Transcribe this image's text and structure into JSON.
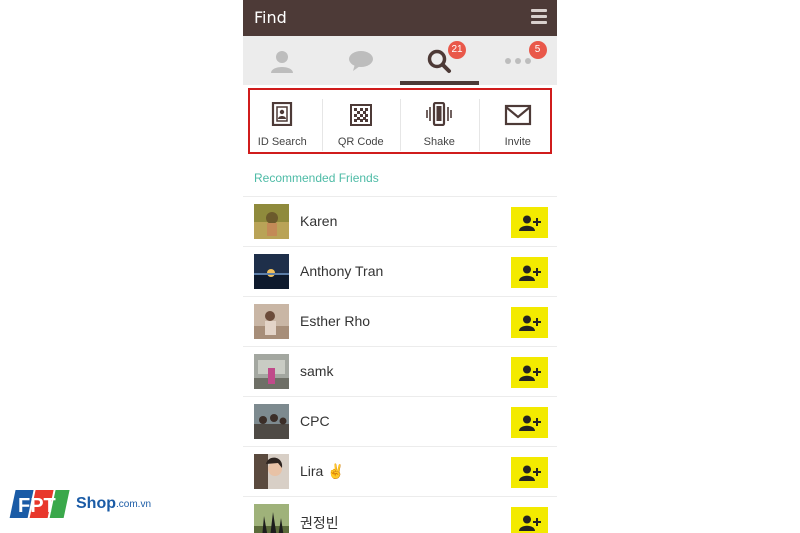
{
  "header": {
    "title": "Find"
  },
  "tabs": [
    {
      "name": "friends",
      "icon": "person-icon",
      "badge": ""
    },
    {
      "name": "chats",
      "icon": "chat-bubble-icon",
      "badge": ""
    },
    {
      "name": "find",
      "icon": "search-icon",
      "badge": "21",
      "active": true
    },
    {
      "name": "more",
      "icon": "more-icon",
      "badge": "5"
    }
  ],
  "actions": [
    {
      "label": "ID Search",
      "icon": "id-card-icon"
    },
    {
      "label": "QR Code",
      "icon": "qr-code-icon"
    },
    {
      "label": "Shake",
      "icon": "shake-phone-icon"
    },
    {
      "label": "Invite",
      "icon": "envelope-icon"
    }
  ],
  "section": {
    "title": "Recommended Friends"
  },
  "friends": [
    {
      "name": "Karen"
    },
    {
      "name": "Anthony Tran"
    },
    {
      "name": "Esther Rho"
    },
    {
      "name": "samk"
    },
    {
      "name": "CPC"
    },
    {
      "name": "Lira ✌"
    },
    {
      "name": "권정빈"
    }
  ],
  "watermark": {
    "brand": "FPT",
    "shop": "Shop",
    "domain": ".com.vn"
  },
  "colors": {
    "header": "#4d3a37",
    "accent": "#4dbba6",
    "badge": "#e9584a",
    "add_button": "#f3ea00",
    "highlight_frame": "#d01c1c"
  }
}
